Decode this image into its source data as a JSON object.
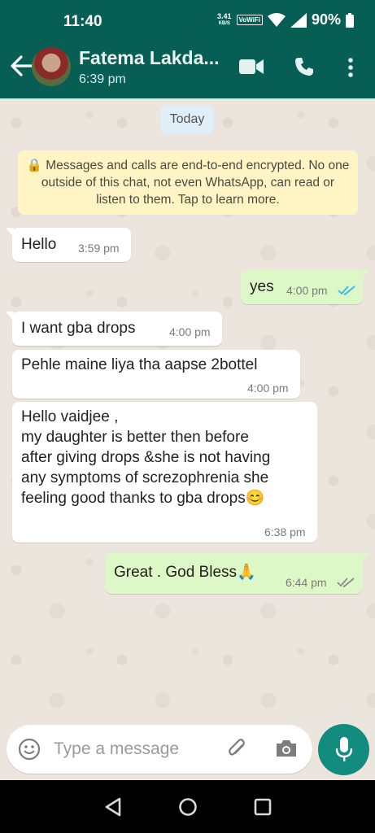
{
  "status_bar": {
    "time": "11:40",
    "network_speed_value": "3.41",
    "network_speed_unit": "KB/S",
    "volte_label": "VoWiFi",
    "battery": "90%"
  },
  "header": {
    "contact_name": "Fatema Lakda...",
    "subtitle": "6:39 pm"
  },
  "chat": {
    "date_chip": "Today",
    "encryption_notice": "🔒 Messages and calls are end-to-end encrypted. No one outside of this chat, not even WhatsApp, can read or listen to them. Tap to learn more.",
    "messages": [
      {
        "direction": "in",
        "text": "Hello",
        "time": "3:59 pm"
      },
      {
        "direction": "out",
        "text": "yes",
        "time": "4:00 pm",
        "status": "read"
      },
      {
        "direction": "in",
        "text": "I want gba drops",
        "time": "4:00 pm"
      },
      {
        "direction": "in",
        "text": "Pehle maine liya tha aapse 2bottel",
        "time": "4:00 pm"
      },
      {
        "direction": "in",
        "text": "Hello vaidjee ,\nmy daughter is better then before\nafter giving drops &she is not having\nany symptoms of screzophrenia she\nfeeling good thanks to gba drops😊",
        "time": "6:38 pm"
      },
      {
        "direction": "out",
        "text": "Great . God Bless🙏",
        "time": "6:44 pm",
        "status": "delivered"
      }
    ]
  },
  "composer": {
    "placeholder": "Type a message"
  },
  "colors": {
    "header": "#075e54",
    "chat_background": "#ece5dd",
    "incoming_bubble": "#ffffff",
    "outgoing_bubble": "#dcf8c6",
    "read_tick": "#34b7f1",
    "mic_button": "#128c7e"
  },
  "icons": [
    "back-arrow-icon",
    "video-call-icon",
    "voice-call-icon",
    "more-options-icon",
    "emoji-icon",
    "attach-icon",
    "camera-icon",
    "mic-icon",
    "nav-back-icon",
    "nav-home-icon",
    "nav-recents-icon"
  ]
}
